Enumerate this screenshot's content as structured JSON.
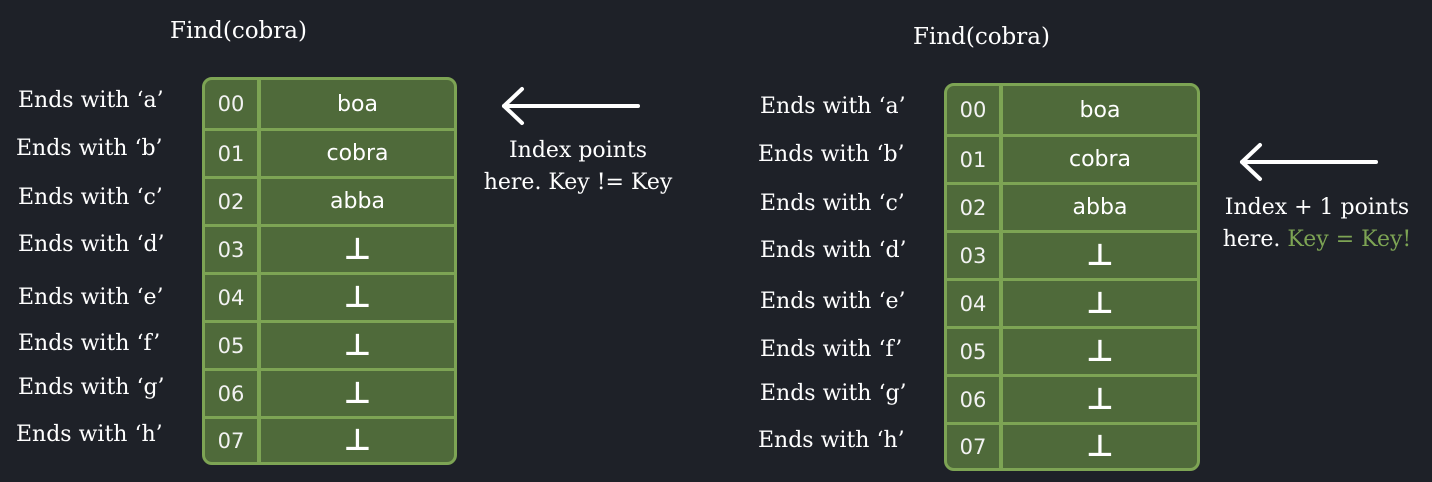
{
  "left": {
    "title": "Find(cobra)",
    "labels": [
      "Ends with ‘a’",
      "Ends with ‘b’",
      "Ends with ‘c’",
      "Ends with ‘d’",
      "Ends with ‘e’",
      "Ends with ‘f’",
      "Ends with ‘g’",
      "Ends with ‘h’"
    ],
    "rows": [
      {
        "index": "00",
        "value": "boa"
      },
      {
        "index": "01",
        "value": "cobra"
      },
      {
        "index": "02",
        "value": "abba"
      },
      {
        "index": "03",
        "value": "⊥"
      },
      {
        "index": "04",
        "value": "⊥"
      },
      {
        "index": "05",
        "value": "⊥"
      },
      {
        "index": "06",
        "value": "⊥"
      },
      {
        "index": "07",
        "value": "⊥"
      }
    ],
    "note_line1": "Index points",
    "note_line2": "here. Key != Key"
  },
  "right": {
    "title": "Find(cobra)",
    "labels": [
      "Ends with ‘a’",
      "Ends with ‘b’",
      "Ends with ‘c’",
      "Ends with ‘d’",
      "Ends with ‘e’",
      "Ends with ‘f’",
      "Ends with ‘g’",
      "Ends with ‘h’"
    ],
    "rows": [
      {
        "index": "00",
        "value": "boa"
      },
      {
        "index": "01",
        "value": "cobra"
      },
      {
        "index": "02",
        "value": "abba"
      },
      {
        "index": "03",
        "value": "⊥"
      },
      {
        "index": "04",
        "value": "⊥"
      },
      {
        "index": "05",
        "value": "⊥"
      },
      {
        "index": "06",
        "value": "⊥"
      },
      {
        "index": "07",
        "value": "⊥"
      }
    ],
    "note_line1": "Index + 1 points",
    "note_line2_plain": "here.",
    "note_line2_highlight": "Key = Key!"
  },
  "colors": {
    "background": "#1e2128",
    "cell_fill": "#4f6a3a",
    "cell_border": "#7da454",
    "highlight_text": "#7da454",
    "text": "#ffffff"
  }
}
